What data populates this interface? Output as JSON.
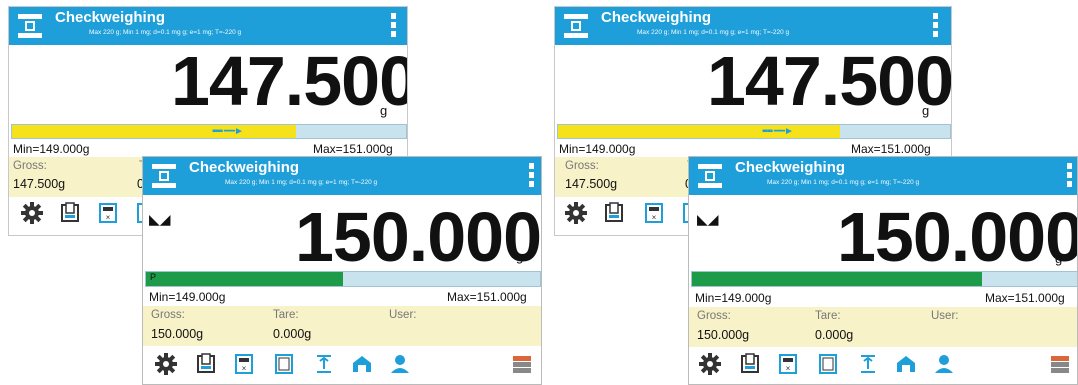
{
  "screens": [
    {
      "title": "Checkweighing",
      "spec": "Max 220 g; Min 1 mg; d=0.1 mg g; e=1 mg; T=-220 g",
      "reading": "147.500",
      "unit": "g",
      "bar_fraction": 0.72,
      "bar_color": "#f6e21a",
      "min": "Min=149.000g",
      "max": "Max=151.000g",
      "gross_label": "Gross:",
      "gross_value": "147.500g",
      "tare_label": "T",
      "tare_value": "0"
    },
    {
      "title": "Checkweighing",
      "spec": "Max 220 g; Min 1 mg; d=0.1 mg g; e=1 mg; T=-220 g",
      "reading": "150.000",
      "unit": "g",
      "bar_fraction": 0.5,
      "bar_color": "#1e9b48",
      "bar_marker": "P",
      "min": "Min=149.000g",
      "max": "Max=151.000g",
      "gross_label": "Gross:",
      "gross_value": "150.000g",
      "tare_label": "Tare:",
      "tare_value": "0.000g",
      "user_label": "User:"
    },
    {
      "title": "Checkweighing",
      "spec": "Max 220 g; Min 1 mg; d=0.1 mg g; e=1 mg; T=-220 g",
      "reading": "147.500",
      "unit": "g",
      "bar_fraction": 0.72,
      "bar_color": "#f6e21a",
      "min": "Min=149.000g",
      "max": "Max=151.000g",
      "gross_label": "Gross:",
      "gross_value": "147.500g",
      "tare_label": "T",
      "tare_value": "0"
    },
    {
      "title": "Checkweighing",
      "spec": "Max 220 g; Min 1 mg; d=0.1 mg g; e=1 mg; T=-220 g",
      "reading": "150.000",
      "unit": "g",
      "bar_fraction": 0.75,
      "bar_color": "#1e9b48",
      "min": "Min=149.000g",
      "max": "Max=151.000g",
      "gross_label": "Gross:",
      "gross_value": "150.000g",
      "tare_label": "Tare:",
      "tare_value": "0.000g",
      "user_label": "User:"
    }
  ],
  "toolbar_icons": [
    "settings-icon",
    "print-icon",
    "calculator-icon",
    "stacked-calculator-icon",
    "tare-icon",
    "warehouse-icon",
    "user-icon",
    "database-icon"
  ],
  "colors": {
    "header": "#1f9fd9",
    "info_panel": "#f7f2c8",
    "ok_bar": "#1e9b48",
    "under_bar": "#f6e21a"
  }
}
